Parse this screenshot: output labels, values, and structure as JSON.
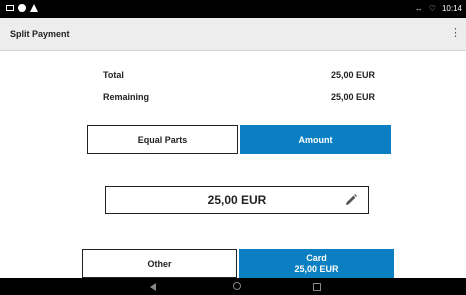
{
  "status_bar": {
    "time": "10:14",
    "network": "↔",
    "wifi": "♡"
  },
  "app_bar": {
    "title": "Split Payment",
    "menu_icon": "⋮"
  },
  "summary": {
    "total_label": "Total",
    "total_value": "25,00 EUR",
    "remaining_label": "Remaining",
    "remaining_value": "25,00 EUR"
  },
  "mode_toggle": {
    "equal_parts_label": "Equal Parts",
    "amount_label": "Amount",
    "selected": "Amount"
  },
  "amount_input": {
    "value": "25,00 EUR"
  },
  "payment_buttons": {
    "other_label": "Other",
    "card_label": "Card",
    "card_amount": "25,00 EUR"
  },
  "colors": {
    "accent": "#0a80c2",
    "app_bar": "#ededed"
  }
}
